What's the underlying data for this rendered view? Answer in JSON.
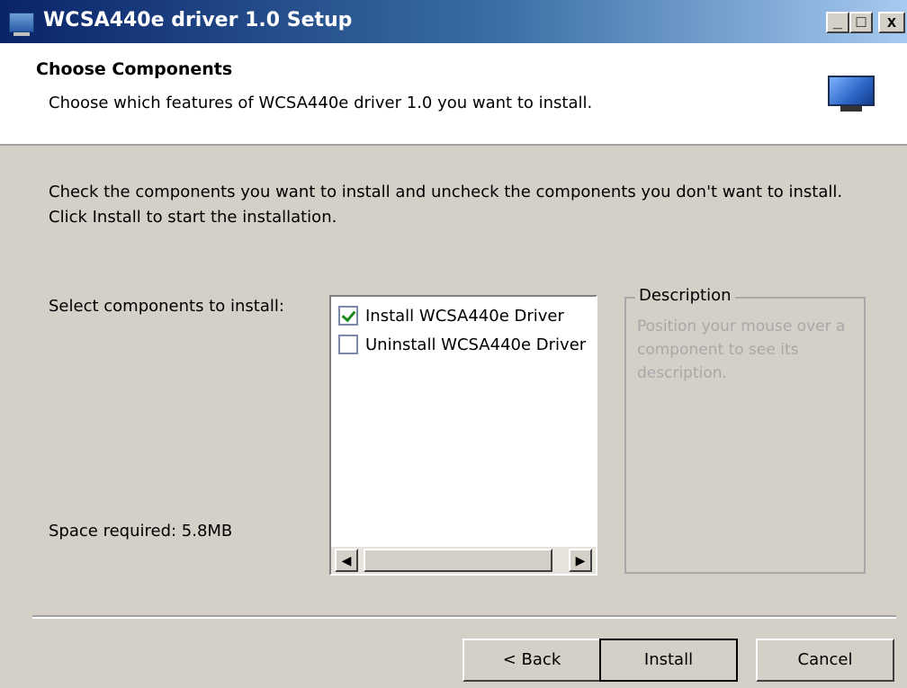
{
  "window": {
    "title": "WCSA440e driver 1.0 Setup",
    "controls": {
      "minimize": "_",
      "maximize": "□",
      "close": "x"
    }
  },
  "header": {
    "title": "Choose Components",
    "subtitle": "Choose which features of WCSA440e driver 1.0 you want to install.",
    "icon": "monitor-icon"
  },
  "body": {
    "instructions": "Check the components you want to install and uncheck the components you don't want to install. Click Install to start the installation.",
    "select_label": "Select components to install:",
    "space_required": "Space required: 5.8MB"
  },
  "components": [
    {
      "label": "Install WCSA440e Driver",
      "checked": true
    },
    {
      "label": "Uninstall WCSA440e Driver",
      "checked": false
    }
  ],
  "scrollbar": {
    "left_arrow": "◀",
    "right_arrow": "▶"
  },
  "description": {
    "legend": "Description",
    "text": "Position your mouse over a component to see its description."
  },
  "buttons": {
    "back": "< Back",
    "install": "Install",
    "cancel": "Cancel"
  }
}
